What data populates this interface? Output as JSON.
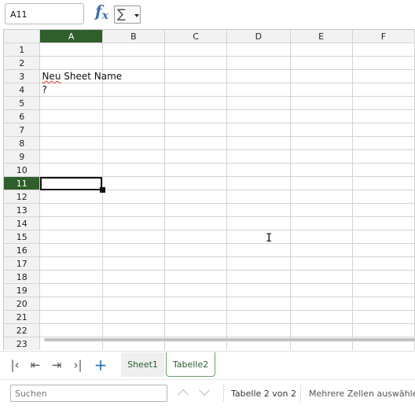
{
  "formula_bar": {
    "cell_reference": "A11",
    "fx_icon": "function-icon",
    "sum_icon": "sigma-icon",
    "sum_glyph": "∑",
    "formula_value": ""
  },
  "grid": {
    "columns": [
      "A",
      "B",
      "C",
      "D",
      "E",
      "F"
    ],
    "rows": [
      "1",
      "2",
      "3",
      "4",
      "5",
      "6",
      "7",
      "8",
      "9",
      "10",
      "11",
      "12",
      "13",
      "14",
      "15",
      "16",
      "17",
      "18",
      "19",
      "20",
      "21",
      "22",
      "23"
    ],
    "active_column": "A",
    "active_row": "11",
    "cells": {
      "A3_prefix": "Neu",
      "A3_rest": " Sheet Name",
      "A4": "?"
    },
    "colors": {
      "active_header": "#2f5f2a",
      "gridline": "#d3d3d3"
    }
  },
  "sheet_nav": {
    "first_icon": "first-sheet-icon",
    "prev_icon": "prev-sheet-icon",
    "next_icon": "next-sheet-icon",
    "last_icon": "last-sheet-icon",
    "add_icon": "add-sheet-icon",
    "glyphs": {
      "first": "K",
      "prev": "⇤",
      "next": "⇥",
      "last": "›I",
      "add": "+"
    }
  },
  "sheet_tabs": [
    {
      "label": "Sheet1",
      "active": false
    },
    {
      "label": "Tabelle2",
      "active": true
    }
  ],
  "find_bar": {
    "search_placeholder": "Suchen",
    "sheet_status": "Tabelle 2 von 2",
    "selection_status": "Mehrere Zellen auswählen"
  }
}
